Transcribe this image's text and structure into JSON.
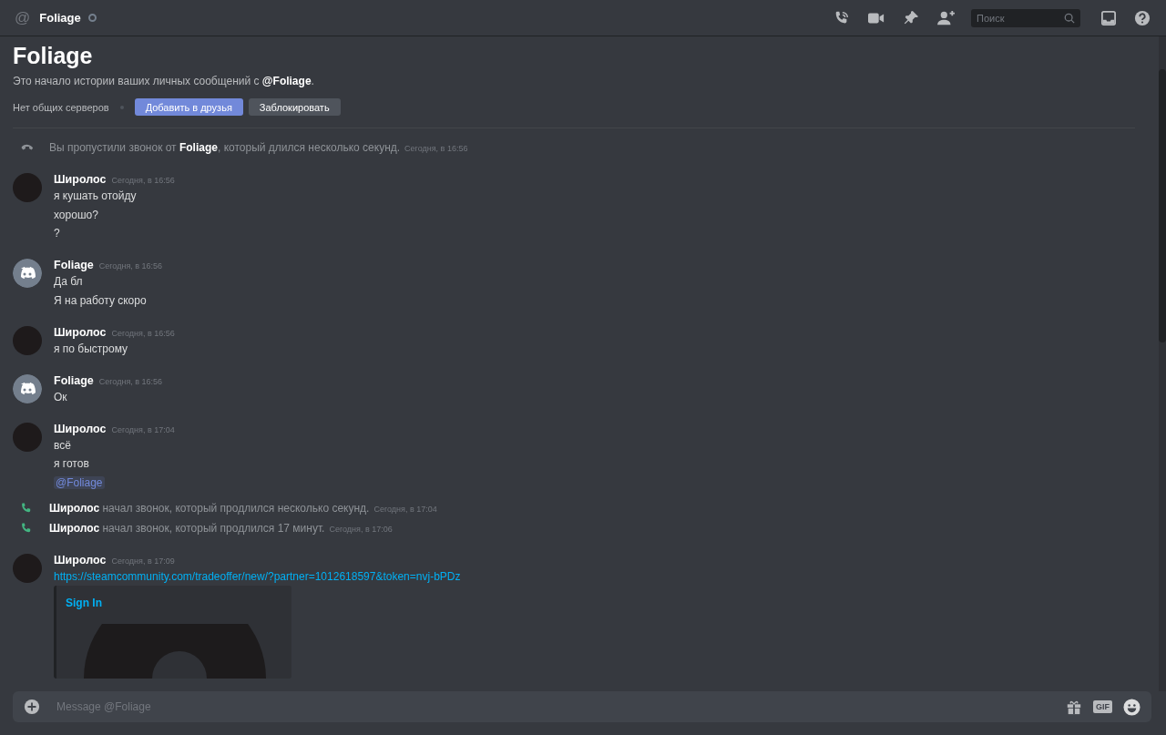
{
  "header": {
    "at_sign": "@",
    "title": "Foliage",
    "search": {
      "placeholder": "Поиск"
    }
  },
  "intro": {
    "title": "Foliage",
    "subtitle": "Это начало истории ваших личных сообщений с **@Foliage**.",
    "mutual_servers": "Нет общих серверов",
    "add_friend_button": "Добавить в друзья",
    "block_button": "Заблокировать"
  },
  "messages": [
    {
      "kind": "call",
      "missed": true,
      "text": "Вы пропустили звонок от **Foliage**, который длился несколько секунд.",
      "timestamp": "Сегодня, в 16:56"
    },
    {
      "kind": "group",
      "avatar": {
        "kind": "photo"
      },
      "author": "Широлос",
      "timestamp": "Сегодня, в 16:56",
      "lines": [
        {
          "kind": "text",
          "text": "я кушать отойду"
        },
        {
          "kind": "text",
          "text": "хорошо?"
        },
        {
          "kind": "text",
          "text": "?"
        }
      ]
    },
    {
      "kind": "group",
      "avatar": {
        "kind": "default"
      },
      "author": "Foliage",
      "timestamp": "Сегодня, в 16:56",
      "lines": [
        {
          "kind": "text",
          "text": "Да бл"
        },
        {
          "kind": "text",
          "text": "Я на работу скоро"
        }
      ]
    },
    {
      "kind": "group",
      "avatar": {
        "kind": "photo"
      },
      "author": "Широлос",
      "timestamp": "Сегодня, в 16:56",
      "lines": [
        {
          "kind": "text",
          "text": "я по быстрому"
        }
      ]
    },
    {
      "kind": "group",
      "avatar": {
        "kind": "default"
      },
      "author": "Foliage",
      "timestamp": "Сегодня, в 16:56",
      "lines": [
        {
          "kind": "text",
          "text": "Ок"
        }
      ]
    },
    {
      "kind": "group",
      "avatar": {
        "kind": "photo"
      },
      "author": "Широлос",
      "timestamp": "Сегодня, в 17:04",
      "lines": [
        {
          "kind": "text",
          "text": "всё"
        },
        {
          "kind": "text",
          "text": "я готов"
        },
        {
          "kind": "mention",
          "text": "@Foliage"
        }
      ]
    },
    {
      "kind": "call",
      "missed": false,
      "text": "**Широлос** начал звонок, который продлился несколько секунд.",
      "timestamp": "Сегодня, в 17:04"
    },
    {
      "kind": "call",
      "missed": false,
      "text": "**Широлос** начал звонок, который продлился 17 минут.",
      "timestamp": "Сегодня, в 17:06"
    },
    {
      "kind": "group",
      "avatar": {
        "kind": "photo"
      },
      "author": "Широлос",
      "timestamp": "Сегодня, в 17:09",
      "lines": [
        {
          "kind": "link",
          "text": "https://steamcommunity.com/tradeoffer/new/?partner=1012618597&token=nvj-bPDz"
        }
      ],
      "embed": {
        "title": "Sign In"
      }
    }
  ],
  "composer": {
    "placeholder": "Message @Foliage",
    "gif_button": "GIF"
  }
}
